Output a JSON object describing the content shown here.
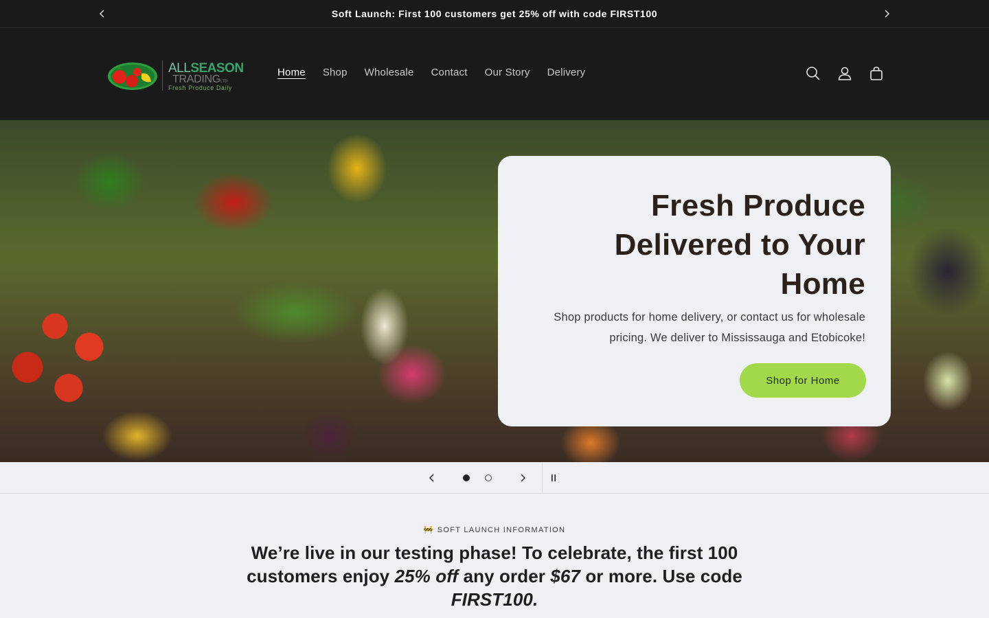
{
  "announcement": {
    "message": "Soft Launch: First 100 customers get 25% off with code FIRST100",
    "prev_icon": "chevron-left-icon",
    "next_icon": "chevron-right-icon"
  },
  "logo": {
    "word1": "ALL",
    "word2": "SEASON",
    "word3": "TRADING",
    "suffix": "LTD",
    "tagline": "Fresh Produce Daily"
  },
  "nav": {
    "items": [
      {
        "label": "Home",
        "active": true
      },
      {
        "label": "Shop"
      },
      {
        "label": "Wholesale"
      },
      {
        "label": "Contact"
      },
      {
        "label": "Our Story"
      },
      {
        "label": "Delivery"
      }
    ]
  },
  "header_icons": [
    "search-icon",
    "account-icon",
    "cart-icon"
  ],
  "hero": {
    "title": "Fresh Produce Delivered to Your Home",
    "text": "Shop products for home delivery, or contact us for wholesale pricing. We deliver to Mississauga and Etobicoke!",
    "button_label": "Shop for Home"
  },
  "slider": {
    "slides_total": 2,
    "current_slide": 1
  },
  "info": {
    "subtitle_emoji": "🚧",
    "subtitle": "SOFT LAUNCH INFORMATION",
    "text_part1": "We’re live in our testing phase! To celebrate, the first 100 customers enjoy ",
    "text_em1": "25% off",
    "text_part2": " any order ",
    "text_em2": "$67",
    "text_part3": " or more. Use code ",
    "text_em3": "FIRST100."
  },
  "colors": {
    "header_bg": "#1a1a1b",
    "page_bg": "#eef0f4",
    "button_green": "#a2d94b",
    "heading_brown": "#2b211b"
  }
}
